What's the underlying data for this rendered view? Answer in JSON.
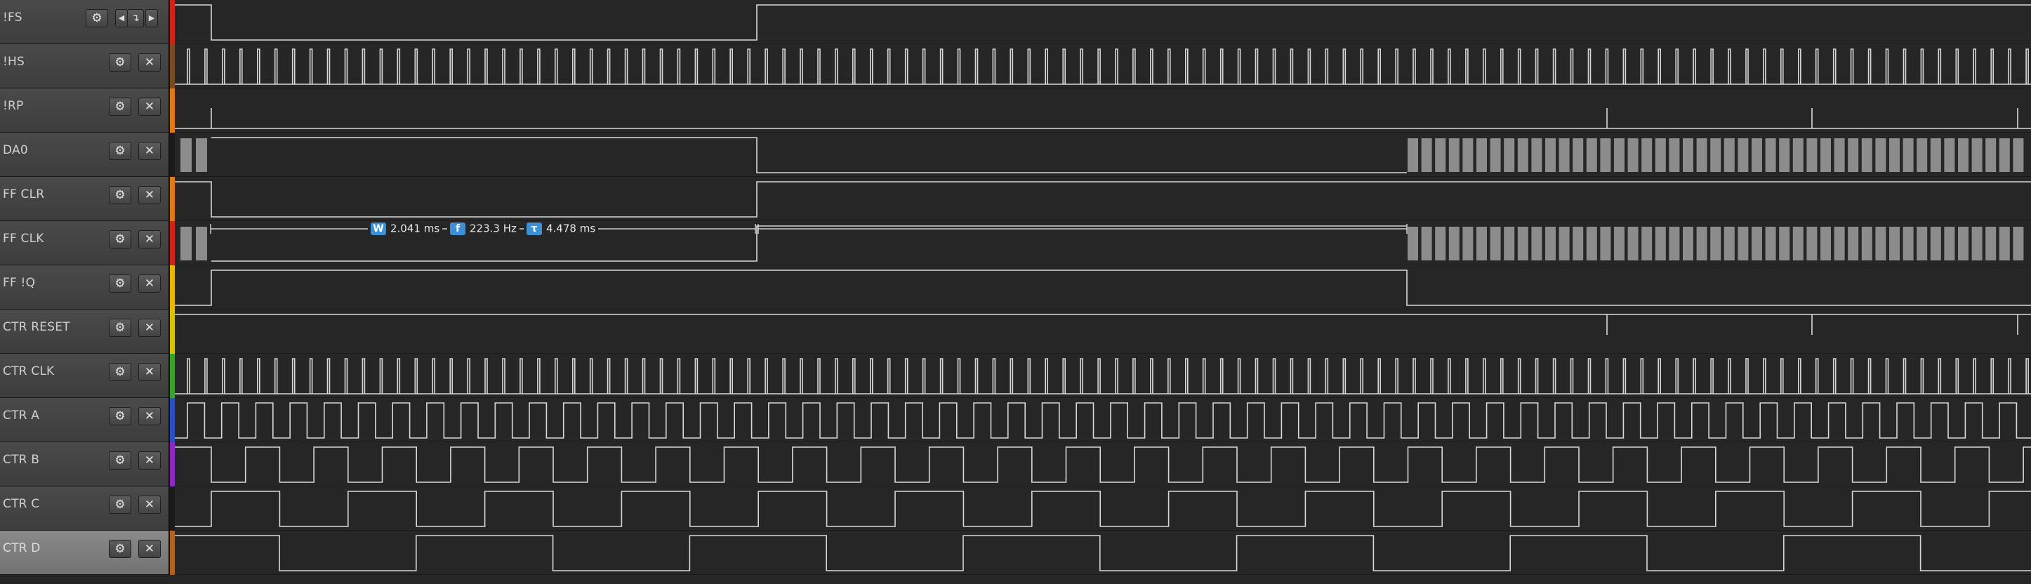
{
  "channels": [
    {
      "label": "!FS",
      "color": "#d2201c",
      "kind": "fs",
      "controls": {
        "gear": "gear-icon",
        "prev": "◀",
        "edge": "↴",
        "next": "▶"
      }
    },
    {
      "label": "!HS",
      "color": "#7a4a1e",
      "kind": "hs"
    },
    {
      "label": "!RP",
      "color": "#e07a10",
      "kind": "rp"
    },
    {
      "label": "DA0",
      "color": "#1a1a1a",
      "kind": "da0"
    },
    {
      "label": "FF CLR",
      "color": "#e07a10",
      "kind": "ffclr"
    },
    {
      "label": "FF CLK",
      "color": "#d2201c",
      "kind": "ffclk"
    },
    {
      "label": "FF !Q",
      "color": "#e6b800",
      "kind": "ffq"
    },
    {
      "label": "CTR RESET",
      "color": "#d9c200",
      "kind": "ctrreset"
    },
    {
      "label": "CTR CLK",
      "color": "#3aa02a",
      "kind": "ctrclk"
    },
    {
      "label": "CTR A",
      "color": "#2a4fc2",
      "kind": "ctra"
    },
    {
      "label": "CTR B",
      "color": "#8a2ac2",
      "kind": "ctrb"
    },
    {
      "label": "CTR C",
      "color": "#1a1a1a",
      "kind": "ctrc"
    },
    {
      "label": "CTR D",
      "color": "#b0621e",
      "kind": "ctrd"
    }
  ],
  "measurement": {
    "width_badge": "W",
    "width": "2.041 ms",
    "freq_badge": "f",
    "frequency": "223.3 Hz",
    "period_badge": "τ",
    "period": "4.478 ms"
  },
  "icons": {
    "gear": "gear-icon",
    "close": "close-icon"
  },
  "colors": {
    "background": "#262626",
    "trace": "#d8d8d8",
    "burst": "#8c8c8c",
    "badge": "#3d8fd6"
  }
}
